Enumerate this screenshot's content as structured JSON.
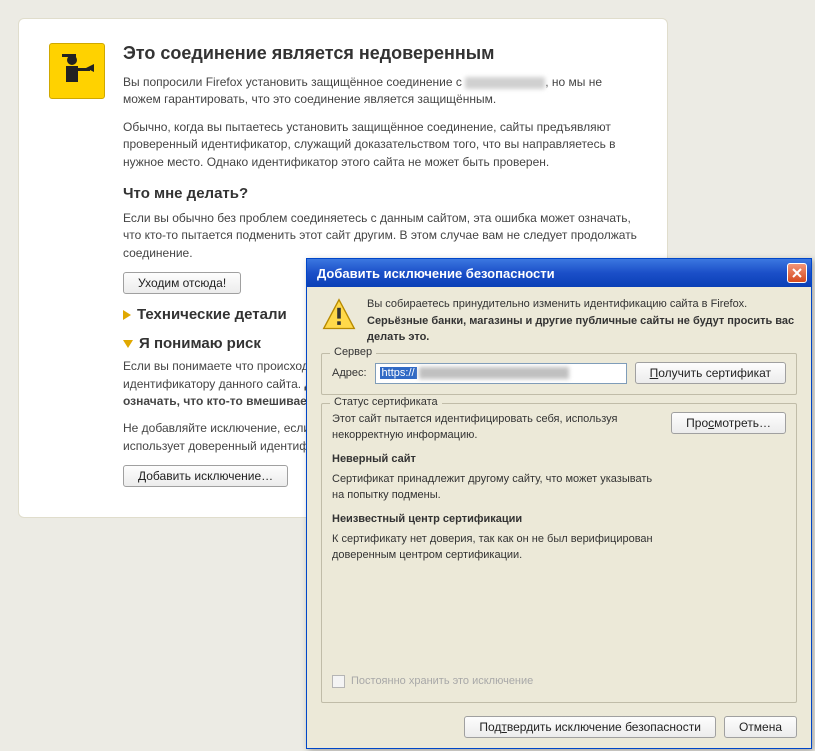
{
  "warning": {
    "title": "Это соединение является недоверенным",
    "p1_a": "Вы попросили Firefox установить защищённое соединение с ",
    "p1_b": ", но мы не можем гарантировать, что это соединение является защищённым.",
    "p2": "Обычно, когда вы пытаетесь установить защищённое соединение, сайты предъявляют проверенный идентификатор, служащий доказательством того, что вы направляетесь в нужное место. Однако идентификатор этого сайта не может быть проверен.",
    "h2": "Что мне делать?",
    "p3": "Если вы обычно без проблем соединяетесь с данным сайтом, эта ошибка может означать, что кто-то пытается подменить этот сайт другим. В этом случае вам не следует продолжать соединение.",
    "leave_btn": "Уходим отсюда!",
    "tech_details": "Технические детали",
    "understand_risk": "Я понимаю риск",
    "risk_p1_a": "Если вы понимаете что происходит, вы можете сказать Firefox начать доверять идентификатору данного сайта. ",
    "risk_p1_b": "Даже если вы доверяете сайту, эта ошибка может означать, что кто-то вмешивается в ваше соединение.",
    "risk_p2": "Не добавляйте исключение, если вы не знаете о веской причине, по которой этот сайт не использует доверенный идентификатор.",
    "add_exc_btn": "Добавить исключение…"
  },
  "dialog": {
    "title": "Добавить исключение безопасности",
    "top_line": "Вы собираетесь принудительно изменить идентификацию сайта в Firefox.",
    "top_bold": "Серьёзные банки, магазины и другие публичные сайты не будут просить вас делать это.",
    "server_legend": "Сервер",
    "addr_label": "Адрес:",
    "addr_value": "https://",
    "get_cert_btn": "Получить сертификат",
    "status_legend": "Статус сертификата",
    "status_p1": "Этот сайт пытается идентифицировать себя, используя некорректную информацию.",
    "view_btn": "Просмотреть…",
    "wrong_site_h": "Неверный сайт",
    "wrong_site_p": "Сертификат принадлежит другому сайту, что может указывать на попытку подмены.",
    "unknown_ca_h": "Неизвестный центр сертификации",
    "unknown_ca_p": "К сертификату нет доверия, так как он не был верифицирован доверенным центром сертификации.",
    "perm_store": "Постоянно хранить это исключение",
    "confirm_btn": "Подтвердить исключение безопасности",
    "cancel_btn": "Отмена"
  }
}
